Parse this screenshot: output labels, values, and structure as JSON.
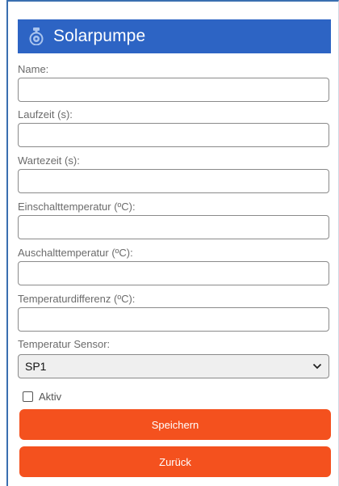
{
  "header": {
    "title": "Solarpumpe",
    "icon": "pump-icon"
  },
  "fields": [
    {
      "label": "Name:",
      "value": ""
    },
    {
      "label": "Laufzeit (s):",
      "value": ""
    },
    {
      "label": "Wartezeit (s):",
      "value": ""
    },
    {
      "label": "Einschalttemperatur (ºC):",
      "value": ""
    },
    {
      "label": "Auschalttemperatur (ºC):",
      "value": ""
    },
    {
      "label": "Temperaturdifferenz (ºC):",
      "value": ""
    }
  ],
  "sensor": {
    "label": "Temperatur Sensor:",
    "selected": "SP1"
  },
  "active": {
    "label": "Aktiv",
    "checked": false
  },
  "buttons": {
    "save": "Speichern",
    "back": "Zurück"
  },
  "colors": {
    "header": "#2d64c4",
    "button": "#f4511e",
    "frame": "#3a6fb0"
  }
}
